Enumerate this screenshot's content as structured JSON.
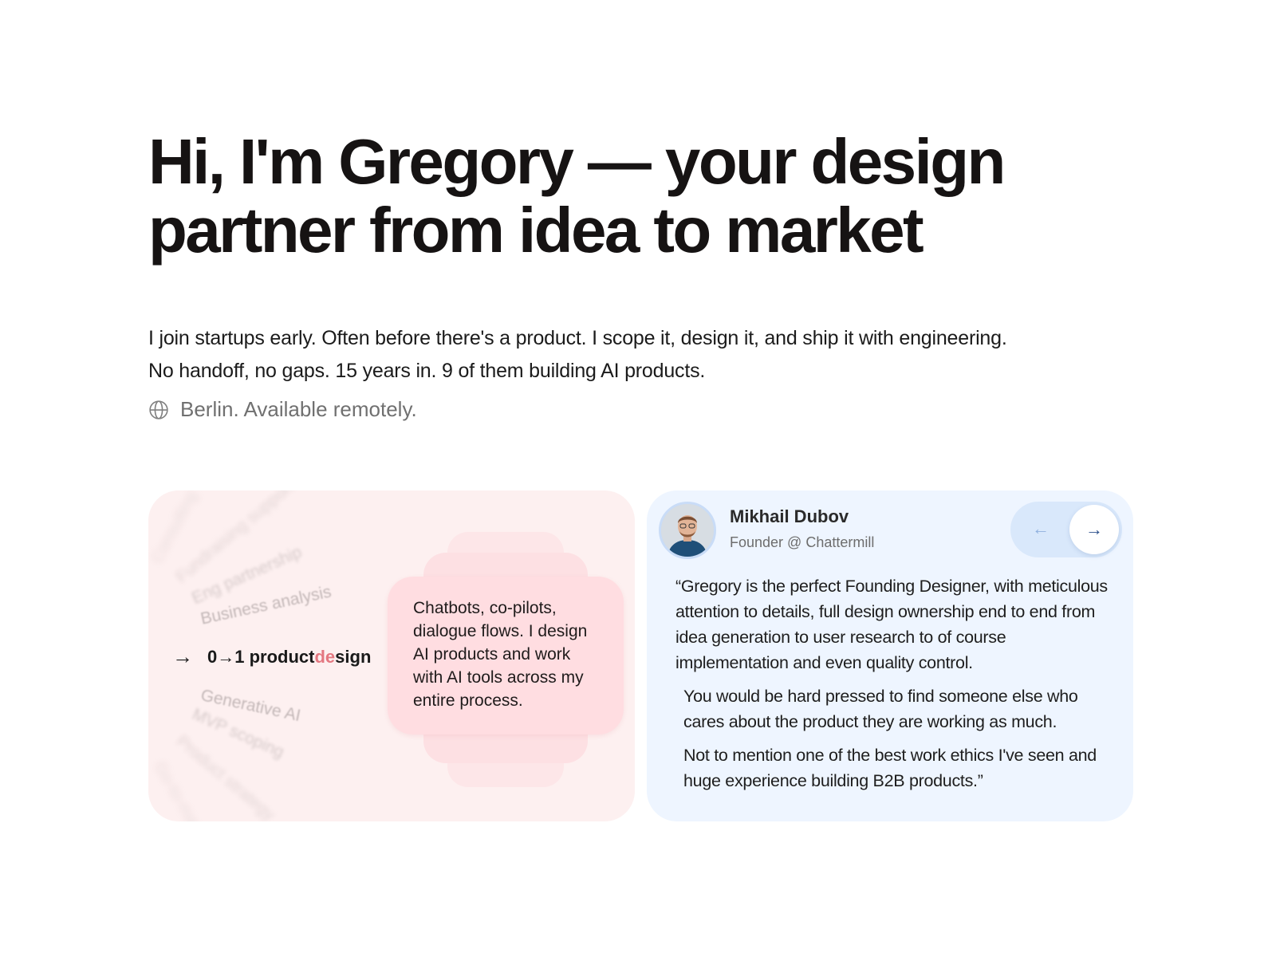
{
  "hero": {
    "title": "Hi, I'm Gregory — your design partner from idea to market",
    "subtitle_line1": "I join startups early. Often before there's a product. I scope it, design it, and ship it with engineering.",
    "subtitle_line2": "No handoff, no gaps. 15 years in. 9 of them building AI products.",
    "location": "Berlin. Available remotely.",
    "location_icon": "globe-icon"
  },
  "services_card": {
    "items_before": [
      "Consulting",
      "Fundraising support",
      "Eng partnership",
      "Business analysis"
    ],
    "active_prefix": "0→1 product ",
    "active_accent": "de",
    "active_suffix": "sign",
    "active_icon": "arrow-right-icon",
    "items_after": [
      "Generative AI",
      "MVP scoping",
      "Product strategy",
      "Go-to-market"
    ],
    "description": "Chatbots, co-pilots, dialogue flows. I design AI products and work with AI tools across my entire process.",
    "accent_color": "#e47780",
    "background": "#fdf0f0"
  },
  "testimonial_card": {
    "author_name": "Mikhail Dubov",
    "author_role": "Founder @ Chattermill",
    "prev_icon": "arrow-left-icon",
    "next_icon": "arrow-right-icon",
    "quote_p1": "“Gregory is the perfect Founding Designer, with meticulous attention to details, full design ownership end to end from idea generation to user research to of course implementation and even quality control.",
    "quote_p2": "You would be hard pressed to find someone else who cares about the product they are working as much.",
    "quote_p3": "Not to mention one of the best work ethics I've seen and huge experience building B2B products.”",
    "background": "#eef5ff"
  }
}
